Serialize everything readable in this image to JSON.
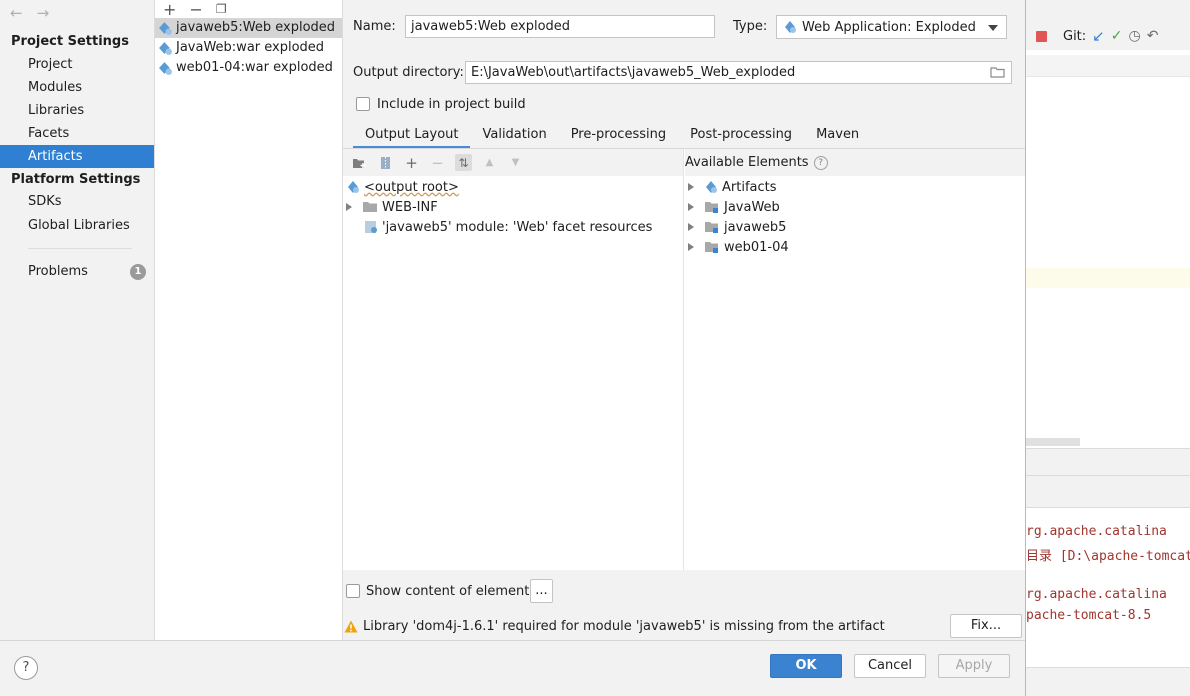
{
  "nav": {
    "project_settings": "Project Settings",
    "project": "Project",
    "modules": "Modules",
    "libraries": "Libraries",
    "facets": "Facets",
    "artifacts": "Artifacts",
    "platform_settings": "Platform Settings",
    "sdks": "SDKs",
    "global_libraries": "Global Libraries",
    "problems": "Problems",
    "problems_count": "1"
  },
  "artifacts": {
    "items": [
      "javaweb5:Web exploded",
      "JavaWeb:war exploded",
      "web01-04:war exploded"
    ],
    "selected": "javaweb5:Web exploded"
  },
  "form": {
    "name_label": "Name:",
    "name_value": "javaweb5:Web exploded",
    "type_label": "Type:",
    "type_value": "Web Application: Exploded",
    "output_dir_label": "Output directory:",
    "output_dir_value": "E:\\JavaWeb\\out\\artifacts\\javaweb5_Web_exploded",
    "include_label": "Include in project build",
    "include_checked": false
  },
  "tabs": [
    "Output Layout",
    "Validation",
    "Pre-processing",
    "Post-processing",
    "Maven"
  ],
  "active_tab": "Output Layout",
  "layout_tree": {
    "root": "<output root>",
    "web_inf": "WEB-INF",
    "facet_resources": "'javaweb5' module: 'Web' facet resources"
  },
  "available": {
    "header": "Available Elements",
    "items": [
      "Artifacts",
      "JavaWeb",
      "javaweb5",
      "web01-04"
    ]
  },
  "show_content_label": "Show content of elements",
  "ellipsis_label": "...",
  "warning": "Library 'dom4j-1.6.1' required for module 'javaweb5' is missing from the artifact",
  "fix_label": "Fix...",
  "buttons": {
    "ok": "OK",
    "cancel": "Cancel",
    "apply": "Apply"
  },
  "help_label": "?",
  "bg_ide": {
    "git_label": "Git:",
    "lines": [
      "rg.apache.catalina",
      "目录 [D:\\apache-tomcat",
      "rg.apache.catalina",
      "pache-tomcat-8.5"
    ]
  },
  "colors": {
    "accent": "#2f7fd2",
    "ok_button": "#3b82d0",
    "warning": "#f0a30a",
    "console_text": "#a0362e"
  }
}
